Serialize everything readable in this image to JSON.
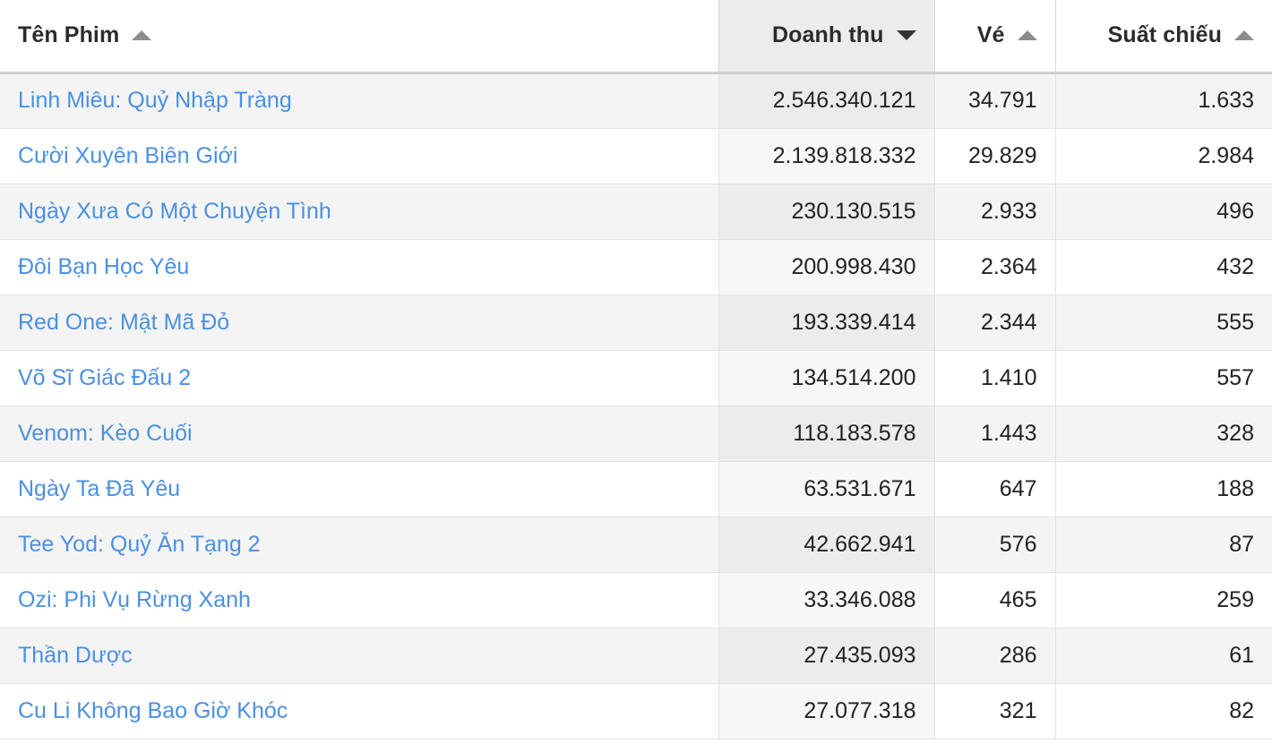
{
  "table": {
    "columns": [
      {
        "key": "name",
        "label": "Tên Phim",
        "sort": "asc",
        "active": false,
        "align": "left"
      },
      {
        "key": "revenue",
        "label": "Doanh thu",
        "sort": "desc",
        "active": true,
        "align": "right"
      },
      {
        "key": "tickets",
        "label": "Vé",
        "sort": "asc",
        "active": false,
        "align": "right"
      },
      {
        "key": "shows",
        "label": "Suất chiếu",
        "sort": "asc",
        "active": false,
        "align": "right"
      }
    ],
    "sort_icons": {
      "asc": "sort-arrow-up-icon",
      "desc": "sort-arrow-down-icon"
    },
    "colors": {
      "link": "#4a90e2",
      "header_text": "#2b2b2b",
      "cell_text": "#222222",
      "row_odd": "#f4f4f4",
      "row_even": "#ffffff",
      "sorted_col_odd": "#ececec",
      "sorted_col_even": "#f7f7f7",
      "border": "#e2e2e2",
      "header_border": "#cfcfcf",
      "sort_arrow_inactive": "#8c8c8c",
      "sort_arrow_active": "#333333"
    },
    "rows": [
      {
        "name": "Linh Miêu: Quỷ Nhập Tràng",
        "revenue": "2.546.340.121",
        "tickets": "34.791",
        "shows": "1.633"
      },
      {
        "name": "Cười Xuyên Biên Giới",
        "revenue": "2.139.818.332",
        "tickets": "29.829",
        "shows": "2.984"
      },
      {
        "name": "Ngày Xưa Có Một Chuyện Tình",
        "revenue": "230.130.515",
        "tickets": "2.933",
        "shows": "496"
      },
      {
        "name": "Đôi Bạn Học Yêu",
        "revenue": "200.998.430",
        "tickets": "2.364",
        "shows": "432"
      },
      {
        "name": "Red One: Mật Mã Đỏ",
        "revenue": "193.339.414",
        "tickets": "2.344",
        "shows": "555"
      },
      {
        "name": "Võ Sĩ Giác Đấu 2",
        "revenue": "134.514.200",
        "tickets": "1.410",
        "shows": "557"
      },
      {
        "name": "Venom: Kèo Cuối",
        "revenue": "118.183.578",
        "tickets": "1.443",
        "shows": "328"
      },
      {
        "name": "Ngày Ta Đã Yêu",
        "revenue": "63.531.671",
        "tickets": "647",
        "shows": "188"
      },
      {
        "name": "Tee Yod: Quỷ Ăn Tạng 2",
        "revenue": "42.662.941",
        "tickets": "576",
        "shows": "87"
      },
      {
        "name": "Ozi: Phi Vụ Rừng Xanh",
        "revenue": "33.346.088",
        "tickets": "465",
        "shows": "259"
      },
      {
        "name": "Thần Dược",
        "revenue": "27.435.093",
        "tickets": "286",
        "shows": "61"
      },
      {
        "name": "Cu Li Không Bao Giờ Khóc",
        "revenue": "27.077.318",
        "tickets": "321",
        "shows": "82"
      }
    ]
  }
}
